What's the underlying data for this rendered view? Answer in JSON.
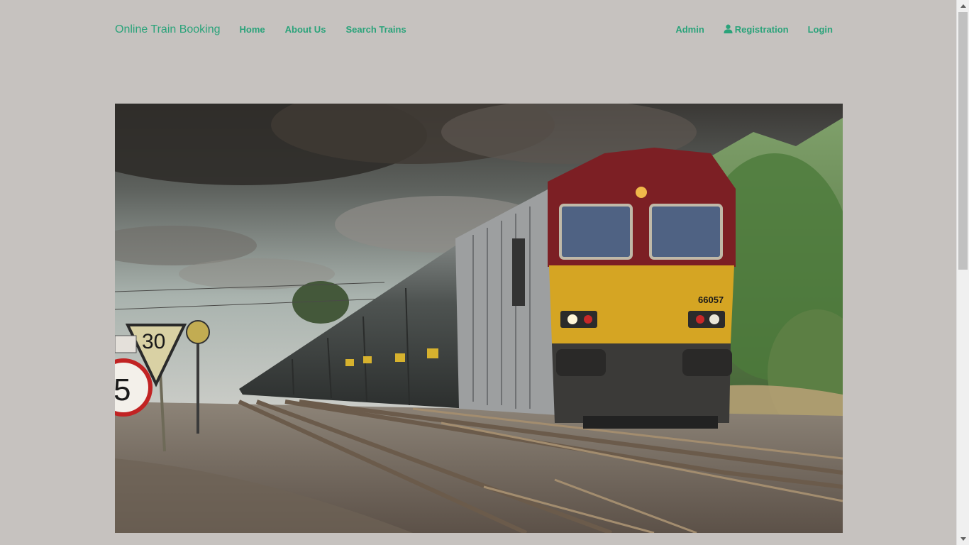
{
  "navbar": {
    "brand": "Online Train Booking",
    "links_left": [
      {
        "label": "Home"
      },
      {
        "label": "About Us"
      },
      {
        "label": "Search Trains"
      }
    ],
    "admin_label": "Admin",
    "registration_label": "Registration",
    "login_label": "Login"
  },
  "hero": {
    "locomotive_number": "66057",
    "speed_sign_30": "30",
    "speed_sign_5": "5"
  },
  "colors": {
    "background": "#c6c2bf",
    "accent": "#2aa37a"
  },
  "icons": {
    "registration": "user-icon"
  }
}
